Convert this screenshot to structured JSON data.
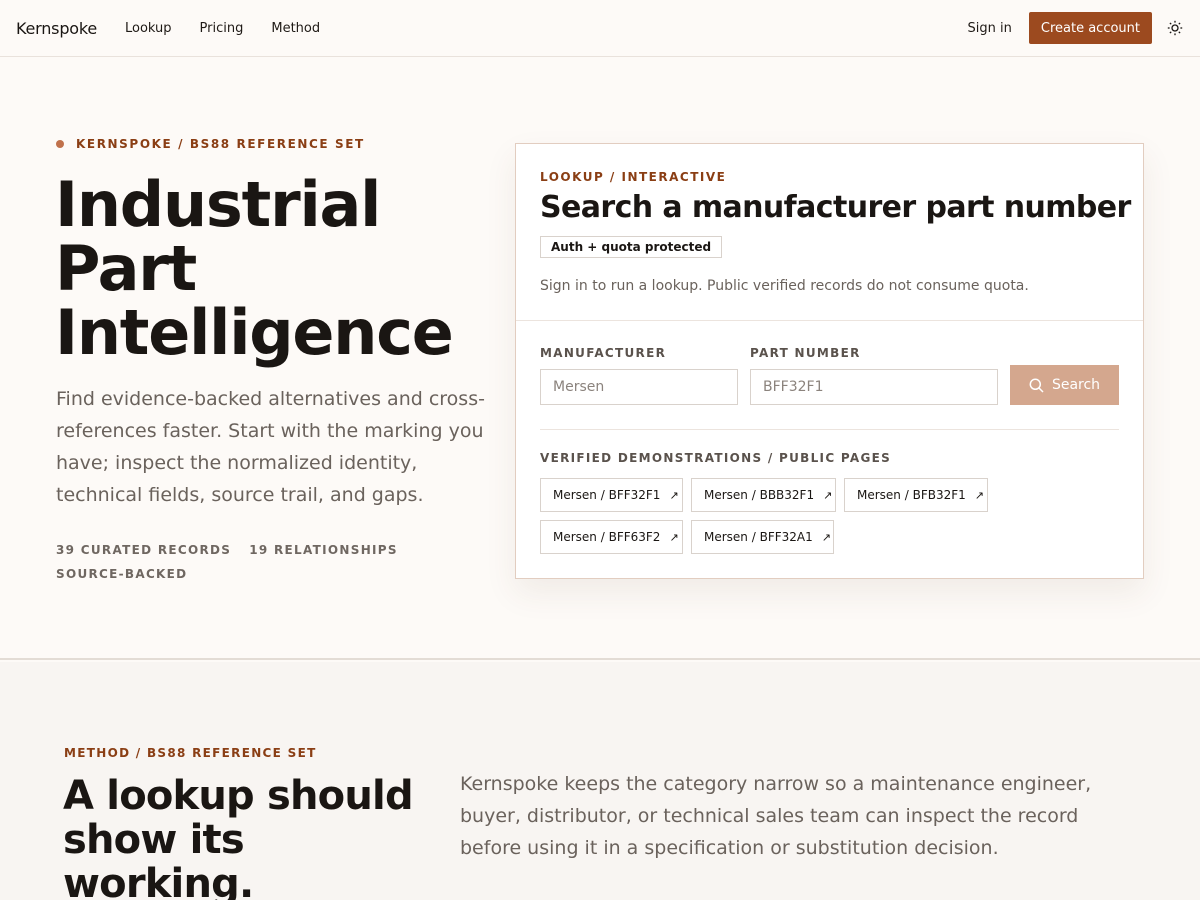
{
  "header": {
    "brand": "Kernspoke",
    "nav": [
      "Lookup",
      "Pricing",
      "Method"
    ],
    "signin": "Sign in",
    "create_account": "Create account",
    "theme_icon": "sun-icon"
  },
  "hero": {
    "eyebrow": "KERNSPOKE / BS88 REFERENCE SET",
    "title_lines": [
      "Industrial",
      "Part",
      "Intelligence"
    ],
    "lede": "Find evidence-backed alternatives and cross-references faster. Start with the marking you have; inspect the normalized identity, technical fields, source trail, and gaps.",
    "stats": [
      "39 CURATED RECORDS",
      "19 RELATIONSHIPS",
      "SOURCE-BACKED"
    ]
  },
  "lookup": {
    "eyebrow": "LOOKUP / INTERACTIVE",
    "title": "Search a manufacturer part number",
    "badge": "Auth + quota protected",
    "note": "Sign in to run a lookup. Public verified records do not consume quota.",
    "manufacturer_label": "MANUFACTURER",
    "manufacturer_placeholder": "Mersen",
    "part_label": "PART NUMBER",
    "part_placeholder": "BFF32F1",
    "search_label": "Search",
    "demos_label": "VERIFIED DEMONSTRATIONS / PUBLIC PAGES",
    "demos": [
      "Mersen / BFF32F1",
      "Mersen / BBB32F1",
      "Mersen / BFB32F1",
      "Mersen / BFF63F2",
      "Mersen / BFF32A1"
    ]
  },
  "method": {
    "eyebrow": "METHOD / BS88 REFERENCE SET",
    "title": "A lookup should show its working.",
    "body": "Kernspoke keeps the category narrow so a maintenance engineer, buyer, distributor, or technical sales team can inspect the record before using it in a specification or substitution decision."
  },
  "colors": {
    "accent": "#9c4a1f",
    "accent_muted": "#d4a78e",
    "eyebrow": "#8a3e14",
    "background": "#fdfaf7"
  }
}
